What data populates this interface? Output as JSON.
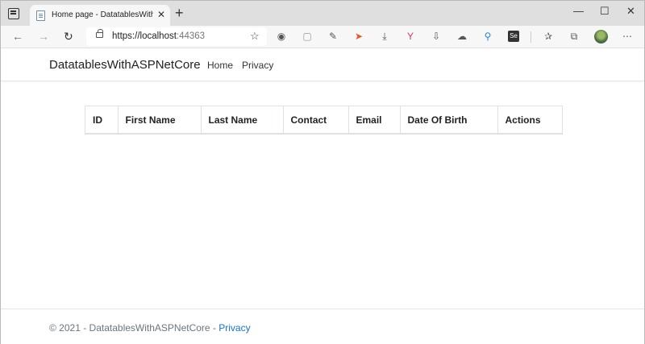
{
  "browser": {
    "tab_title": "Home page - DatatablesWithASP",
    "url_main": "https://localhost",
    "url_port": ":44363"
  },
  "site": {
    "brand": "DatatablesWithASPNetCore",
    "nav": [
      "Home",
      "Privacy"
    ]
  },
  "table": {
    "columns": [
      "ID",
      "First Name",
      "Last Name",
      "Contact",
      "Email",
      "Date Of Birth",
      "Actions"
    ],
    "rows": []
  },
  "footer": {
    "text": "© 2021 - DatatablesWithASPNetCore - ",
    "link": "Privacy"
  }
}
